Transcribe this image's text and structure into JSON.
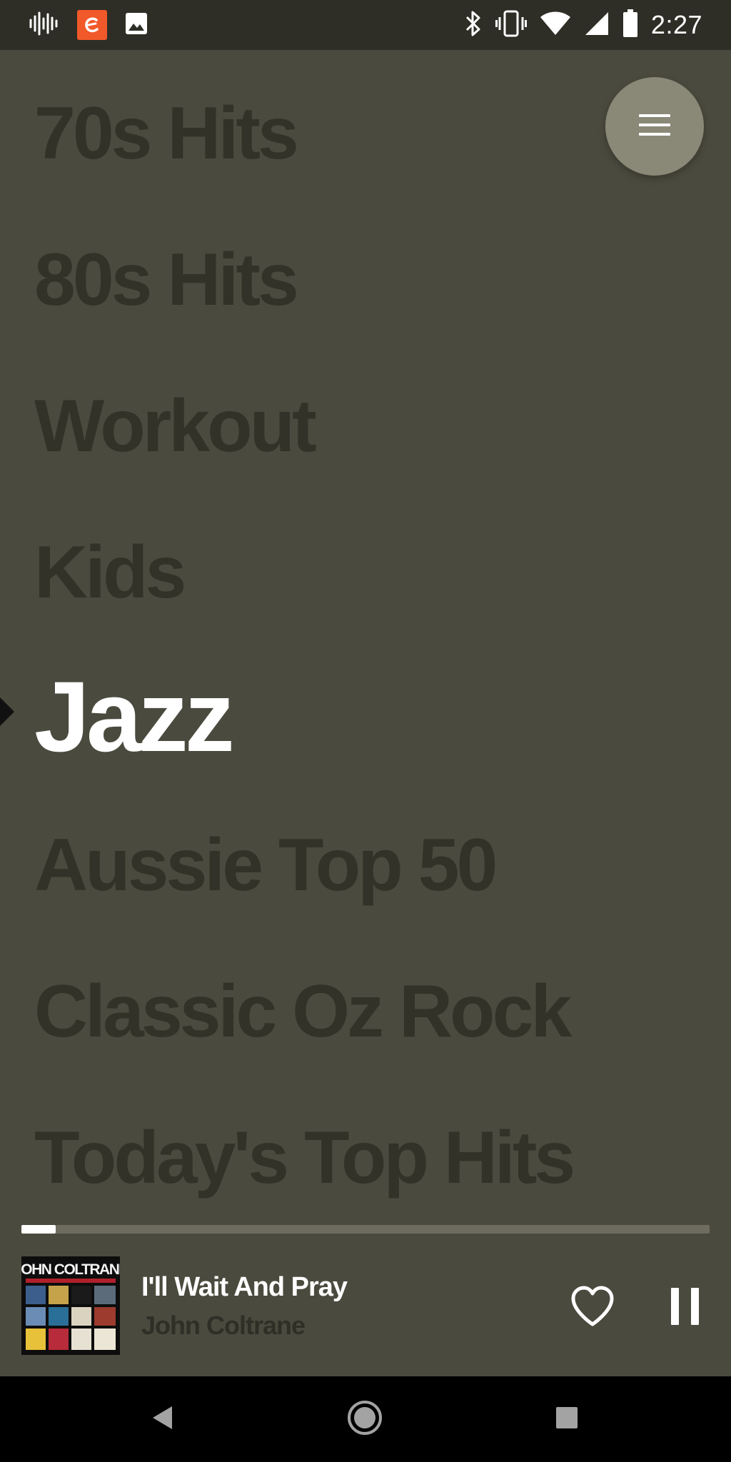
{
  "status_bar": {
    "time": "2:27",
    "left_icons": [
      "sound-wave-icon",
      "app-badge-icon",
      "image-icon"
    ],
    "right_icons": [
      "bluetooth-icon",
      "vibrate-icon",
      "wifi-icon",
      "cell-signal-icon",
      "battery-icon"
    ]
  },
  "menu_button": {
    "icon": "hamburger-menu-icon"
  },
  "stations": {
    "items": [
      {
        "label": "70s Hits"
      },
      {
        "label": "80s Hits"
      },
      {
        "label": "Workout"
      },
      {
        "label": "Kids"
      },
      {
        "label": "Jazz",
        "active": true
      },
      {
        "label": "Aussie Top 50"
      },
      {
        "label": "Classic Oz Rock"
      },
      {
        "label": "Today's Top Hits"
      }
    ]
  },
  "now_playing": {
    "title": "I'll Wait And Pray",
    "artist": "John Coltrane",
    "progress": 0.05,
    "album_art": "john-coltrane-album-art"
  },
  "colors": {
    "background": "#4a4a3e",
    "inactive_text": "#323229",
    "active_text": "#ffffff",
    "menu_button": "#8a8877",
    "app_badge": "#f2592a"
  }
}
